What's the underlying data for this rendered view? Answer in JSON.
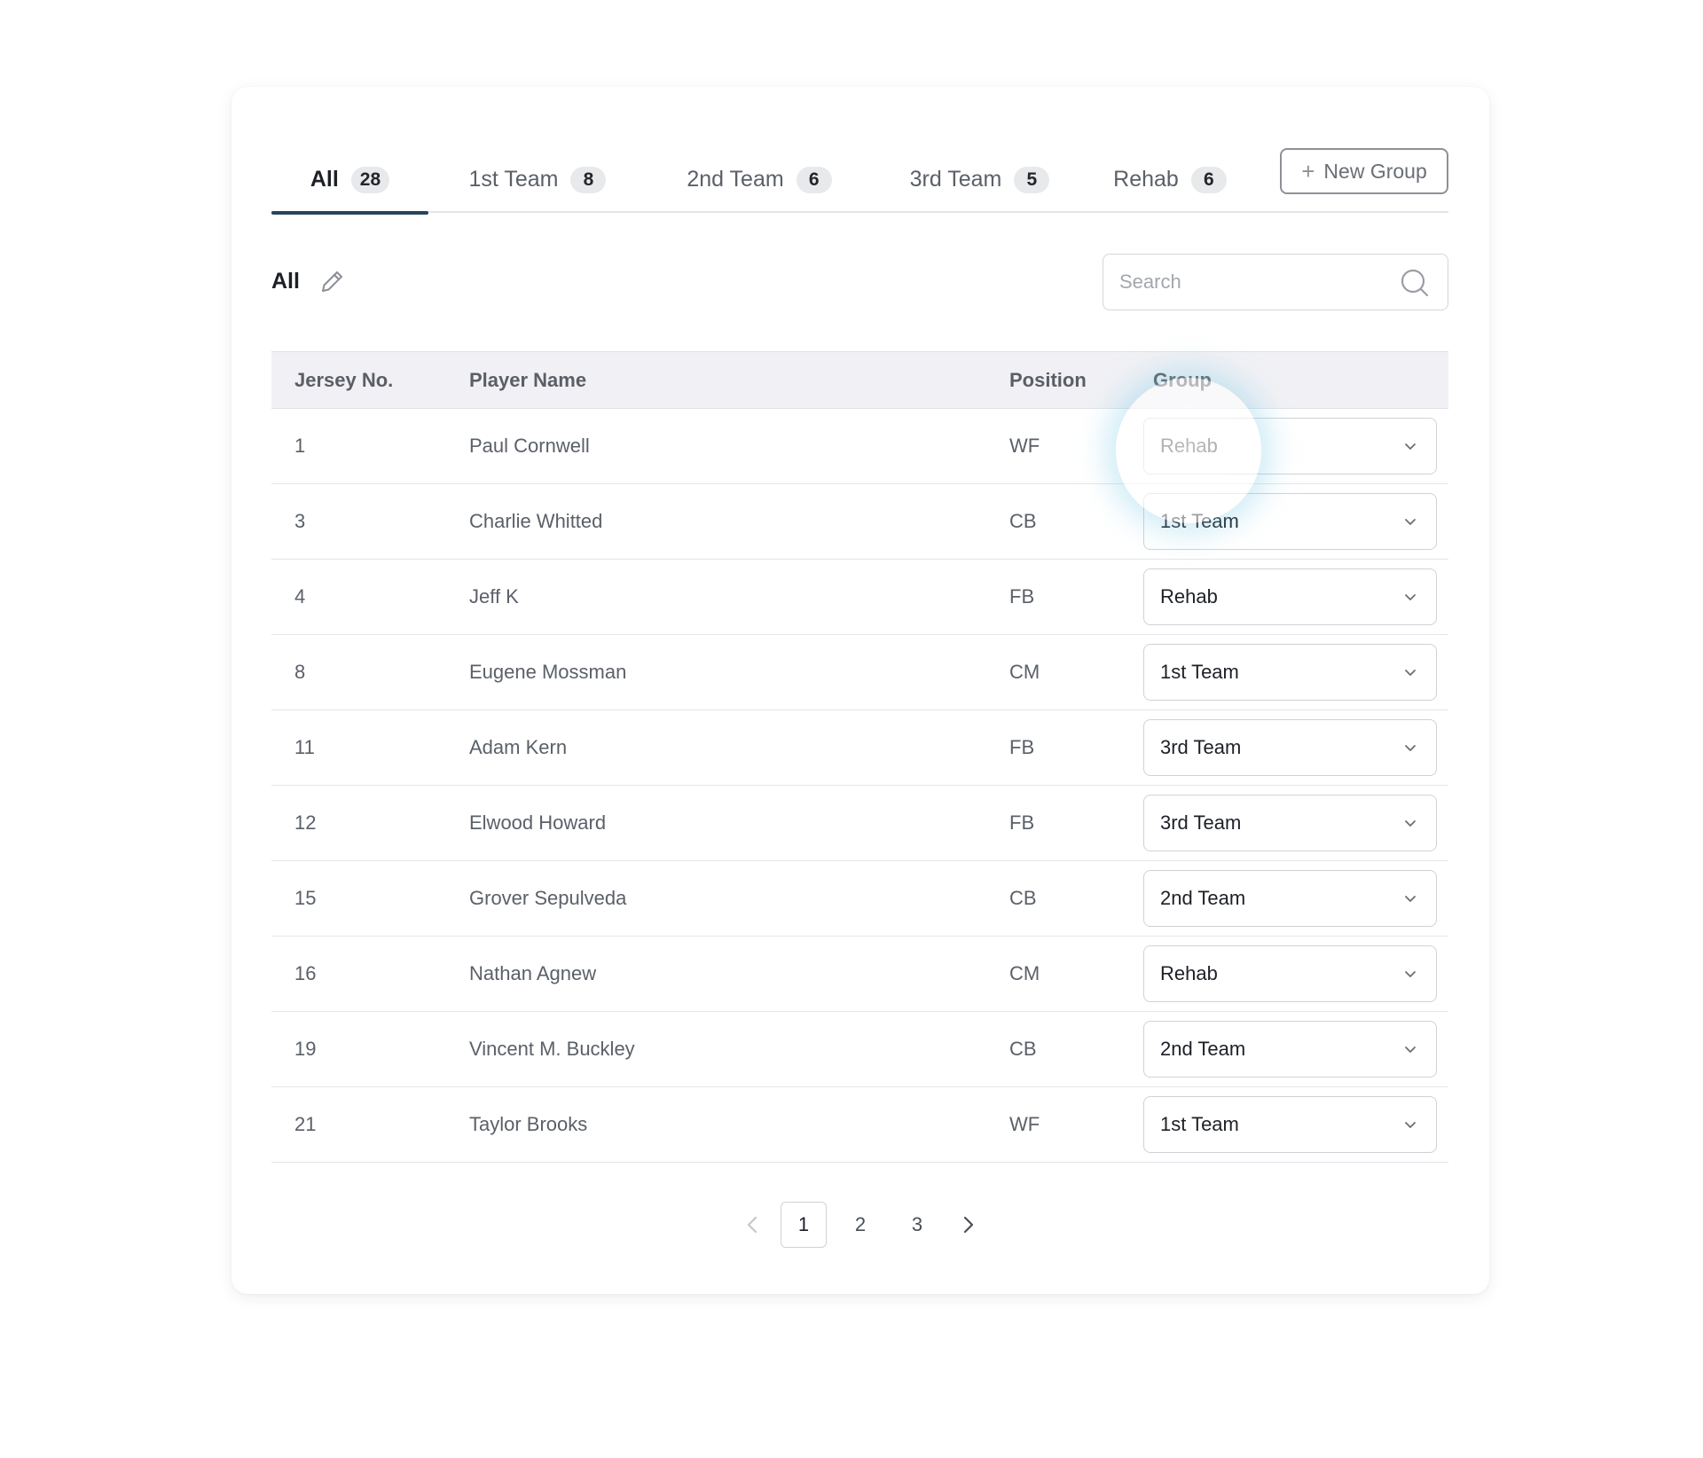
{
  "tabs": [
    {
      "label": "All",
      "count": "28",
      "active": true
    },
    {
      "label": "1st Team",
      "count": "8",
      "active": false
    },
    {
      "label": "2nd Team",
      "count": "6",
      "active": false
    },
    {
      "label": "3rd Team",
      "count": "5",
      "active": false
    },
    {
      "label": "Rehab",
      "count": "6",
      "active": false
    }
  ],
  "new_group": {
    "icon": "plus-icon",
    "label": "New Group"
  },
  "current_group": {
    "title": "All",
    "edit_icon": "pencil-icon"
  },
  "search": {
    "placeholder": "Search",
    "value": "",
    "icon": "search-icon"
  },
  "table": {
    "columns": [
      "Jersey No.",
      "Player Name",
      "Position",
      "Group"
    ],
    "rows": [
      {
        "jersey": "1",
        "name": "Paul Cornwell",
        "position": "WF",
        "group": "Rehab"
      },
      {
        "jersey": "3",
        "name": "Charlie Whitted",
        "position": "CB",
        "group": "1st Team"
      },
      {
        "jersey": "4",
        "name": "Jeff K",
        "position": "FB",
        "group": "Rehab"
      },
      {
        "jersey": "8",
        "name": "Eugene Mossman",
        "position": "CM",
        "group": "1st Team"
      },
      {
        "jersey": "11",
        "name": "Adam Kern",
        "position": "FB",
        "group": "3rd Team"
      },
      {
        "jersey": "12",
        "name": "Elwood Howard",
        "position": "FB",
        "group": "3rd Team"
      },
      {
        "jersey": "15",
        "name": "Grover Sepulveda",
        "position": "CB",
        "group": "2nd Team"
      },
      {
        "jersey": "16",
        "name": "Nathan Agnew",
        "position": "CM",
        "group": "Rehab"
      },
      {
        "jersey": "19",
        "name": "Vincent M. Buckley",
        "position": "CB",
        "group": "2nd Team"
      },
      {
        "jersey": "21",
        "name": "Taylor Brooks",
        "position": "WF",
        "group": "1st Team"
      }
    ]
  },
  "pagination": {
    "pages": [
      "1",
      "2",
      "3"
    ],
    "current": "1"
  },
  "colors": {
    "accent": "#25455e",
    "badge_bg": "#e8e9eb",
    "header_bg": "#f1f1f5"
  }
}
